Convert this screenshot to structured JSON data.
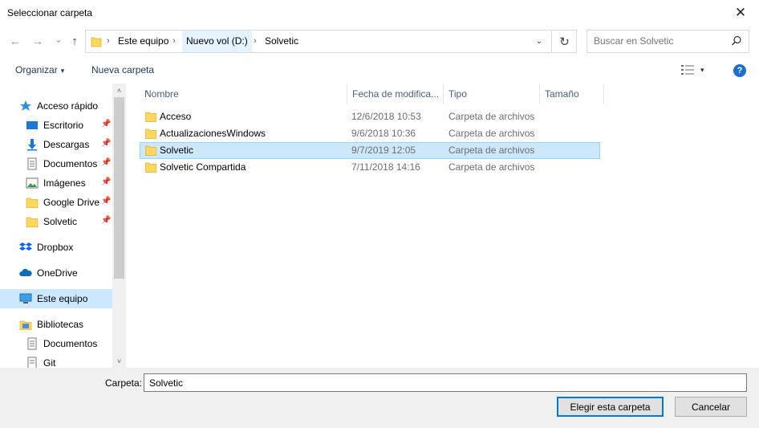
{
  "window": {
    "title": "Seleccionar carpeta",
    "close_glyph": "✕"
  },
  "nav": {
    "back_glyph": "←",
    "forward_glyph": "→",
    "recent_glyph": "⌄",
    "up_glyph": "↑",
    "refresh_glyph": "↻",
    "dropdown_glyph": "⌄",
    "breadcrumb": [
      "Este equipo",
      "Nuevo vol (D:)",
      "Solvetic"
    ],
    "separator": "›"
  },
  "search": {
    "placeholder": "Buscar en Solvetic"
  },
  "toolbar": {
    "organize_label": "Organizar",
    "new_folder_label": "Nueva carpeta",
    "caret": "▾",
    "help_glyph": "?"
  },
  "sidebar": {
    "items": [
      {
        "label": "Acceso rápido",
        "icon": "star-icon"
      },
      {
        "label": "Escritorio",
        "icon": "desktop-icon",
        "pinned": true
      },
      {
        "label": "Descargas",
        "icon": "download-icon",
        "pinned": true
      },
      {
        "label": "Documentos",
        "icon": "document-icon",
        "pinned": true
      },
      {
        "label": "Imágenes",
        "icon": "pictures-icon",
        "pinned": true
      },
      {
        "label": "Google Drive",
        "icon": "folder-icon",
        "pinned": true
      },
      {
        "label": "Solvetic",
        "icon": "folder-icon",
        "pinned": true
      },
      {
        "label": "Dropbox",
        "icon": "dropbox-icon"
      },
      {
        "label": "OneDrive",
        "icon": "cloud-icon"
      },
      {
        "label": "Este equipo",
        "icon": "computer-icon",
        "selected": true
      },
      {
        "label": "Bibliotecas",
        "icon": "library-icon"
      },
      {
        "label": "Documentos",
        "icon": "document-icon"
      },
      {
        "label": "Git",
        "icon": "document-icon"
      }
    ],
    "pin_glyph": "📌",
    "scroll_up": "˄",
    "scroll_down": "˅"
  },
  "columns": {
    "name": "Nombre",
    "date": "Fecha de modifica...",
    "type": "Tipo",
    "size": "Tamaño",
    "sort_glyph": "˄"
  },
  "files": [
    {
      "name": "Acceso",
      "date": "12/6/2018 10:53",
      "type": "Carpeta de archivos"
    },
    {
      "name": "ActualizacionesWindows",
      "date": "9/6/2018 10:36",
      "type": "Carpeta de archivos"
    },
    {
      "name": "Solvetic",
      "date": "9/7/2019 12:05",
      "type": "Carpeta de archivos",
      "selected": true
    },
    {
      "name": "Solvetic Compartida",
      "date": "7/11/2018 14:16",
      "type": "Carpeta de archivos"
    }
  ],
  "footer": {
    "folder_label": "Carpeta:",
    "folder_value": "Solvetic",
    "choose_label": "Elegir esta carpeta",
    "cancel_label": "Cancelar"
  },
  "colors": {
    "accent": "#0078d7",
    "selection": "#cce8ff",
    "folder": "#ffd75e"
  }
}
